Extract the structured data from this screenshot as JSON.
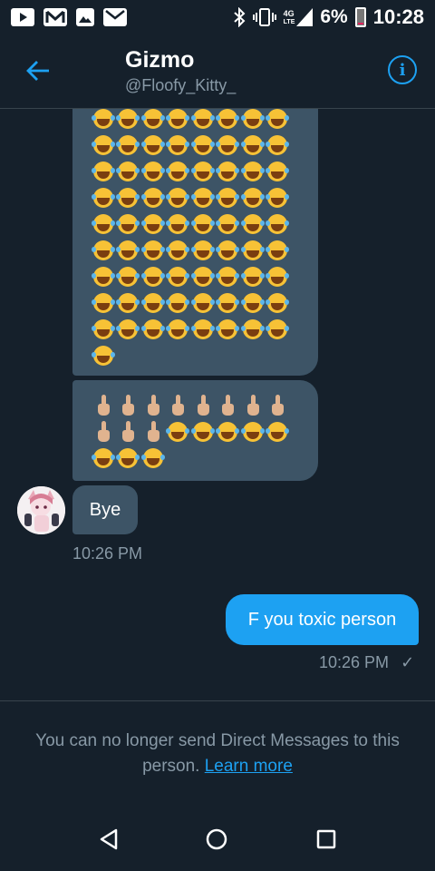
{
  "status_bar": {
    "network": "4G",
    "network_sub": "LTE",
    "battery": "6%",
    "time": "10:28",
    "icons": [
      "youtube-icon",
      "gmail-icon",
      "gallery-icon",
      "mail-icon",
      "bluetooth-icon",
      "vibrate-icon",
      "signal-icon",
      "battery-icon"
    ]
  },
  "header": {
    "title": "Gizmo",
    "handle": "@Floofy_Kitty_",
    "icons": [
      "back-arrow-icon",
      "info-icon"
    ]
  },
  "messages": {
    "incoming_1": {
      "emoji": "😂",
      "rows": 9,
      "extra": 1,
      "emoji_count": 73
    },
    "incoming_2": {
      "finger_emoji": "🖕🏼",
      "finger_count": 11,
      "laugh_count": 8
    },
    "incoming_3": {
      "text": "Bye"
    },
    "incoming_time": "10:26 PM",
    "outgoing": {
      "text": "F you toxic person"
    },
    "outgoing_time": "10:26 PM",
    "outgoing_status": "✓"
  },
  "footer": {
    "notice": "You can no longer send Direct Messages to this person.",
    "link": "Learn more"
  },
  "colors": {
    "background": "#15202b",
    "incoming_bubble": "#3d5466",
    "outgoing_bubble": "#1da1f2",
    "secondary_text": "#8899a6",
    "accent": "#1da1f2"
  }
}
